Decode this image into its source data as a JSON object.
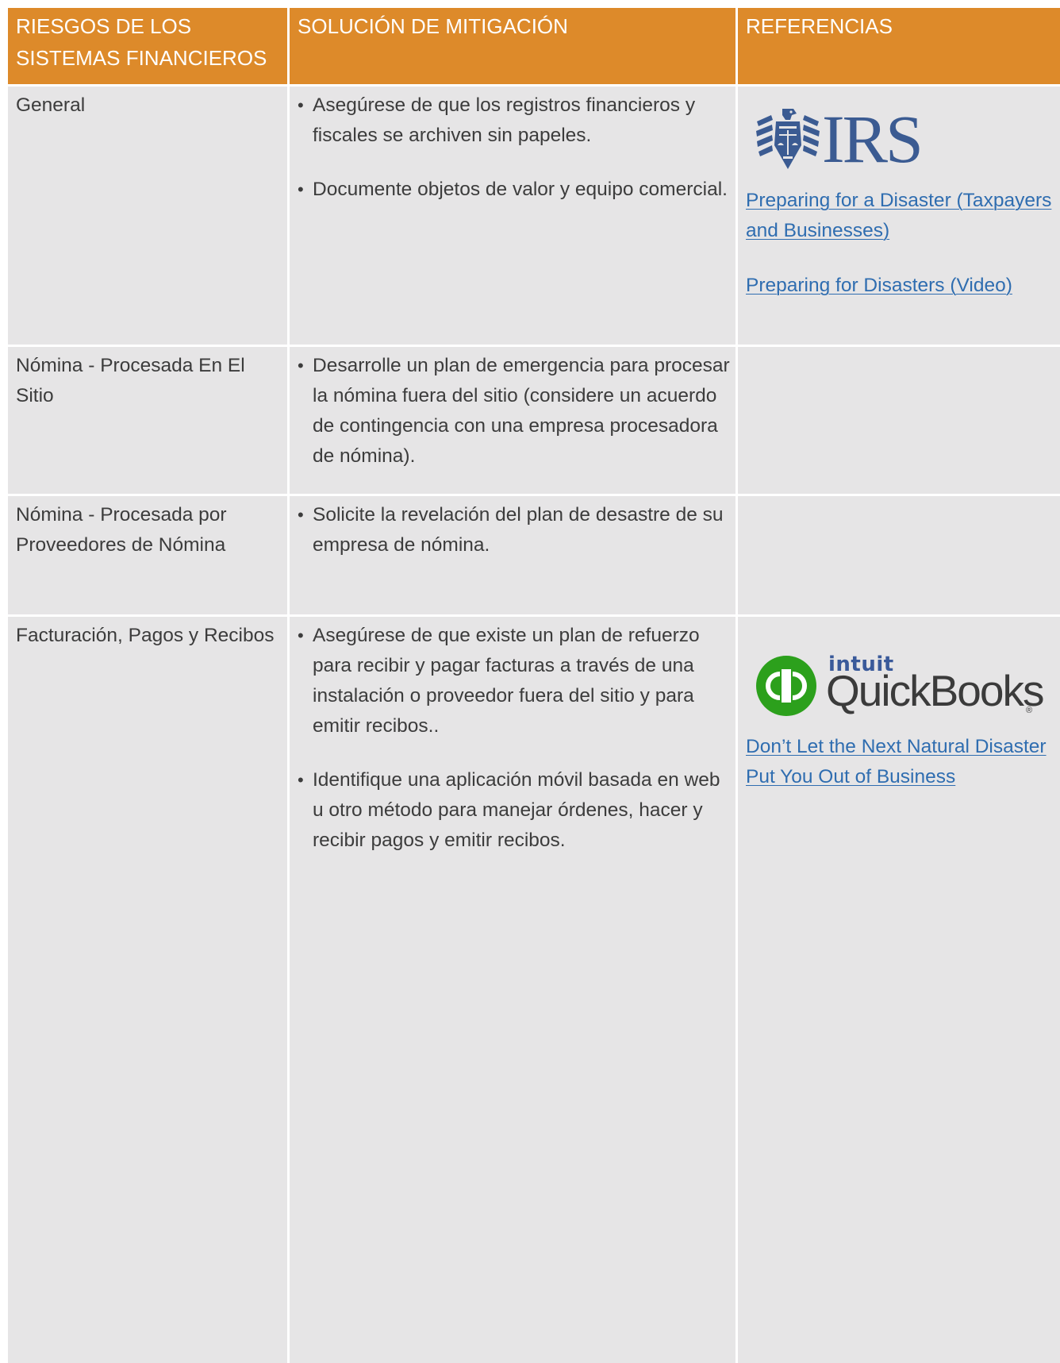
{
  "header": {
    "risks": "RIESGOS DE LOS SISTEMAS FINANCIEROS",
    "solution": "SOLUCIÓN DE MITIGACIÓN",
    "references": "REFERENCIAS"
  },
  "rows": [
    {
      "risk": "General",
      "solutions": [
        "Asegúrese de que los registros financieros y fiscales se archiven sin papeles.",
        "Documente objetos de valor y equipo comercial."
      ],
      "logo": "IRS",
      "links": [
        "Preparing for a Disaster (Taxpayers and Businesses)",
        "Preparing for Disasters (Video)"
      ]
    },
    {
      "risk": "Nómina - Procesada En El Sitio",
      "solutions": [
        "Desarrolle un plan de emergencia para procesar la nómina fuera del sitio (considere un acuerdo de contingencia con una empresa procesadora de nómina)."
      ]
    },
    {
      "risk": "Nómina - Procesada por Proveedores de Nómina",
      "solutions": [
        "Solicite la revelación del plan de desastre de su empresa de nómina."
      ]
    },
    {
      "risk": "Facturación, Pagos y Recibos",
      "solutions": [
        "Asegúrese de que existe un plan de refuerzo para recibir y pagar facturas a través de una instalación o proveedor fuera del sitio y para emitir recibos..",
        "Identifique una aplicación móvil basada en web u otro método para manejar órdenes, hacer y recibir pagos y emitir recibos."
      ],
      "logo_brand": "intuit",
      "logo_product": "QuickBooks",
      "links": [
        "Don’t Let the Next Natural Disaster Put You Out of Business"
      ]
    }
  ],
  "colors": {
    "header": "#dd8a2a",
    "cell": "#e6e5e6",
    "link": "#2f6db0",
    "irs": "#3b5b92",
    "quickbooks_green": "#2ca01c"
  },
  "icons": [
    "irs-eagle-icon",
    "quickbooks-qb-icon"
  ]
}
